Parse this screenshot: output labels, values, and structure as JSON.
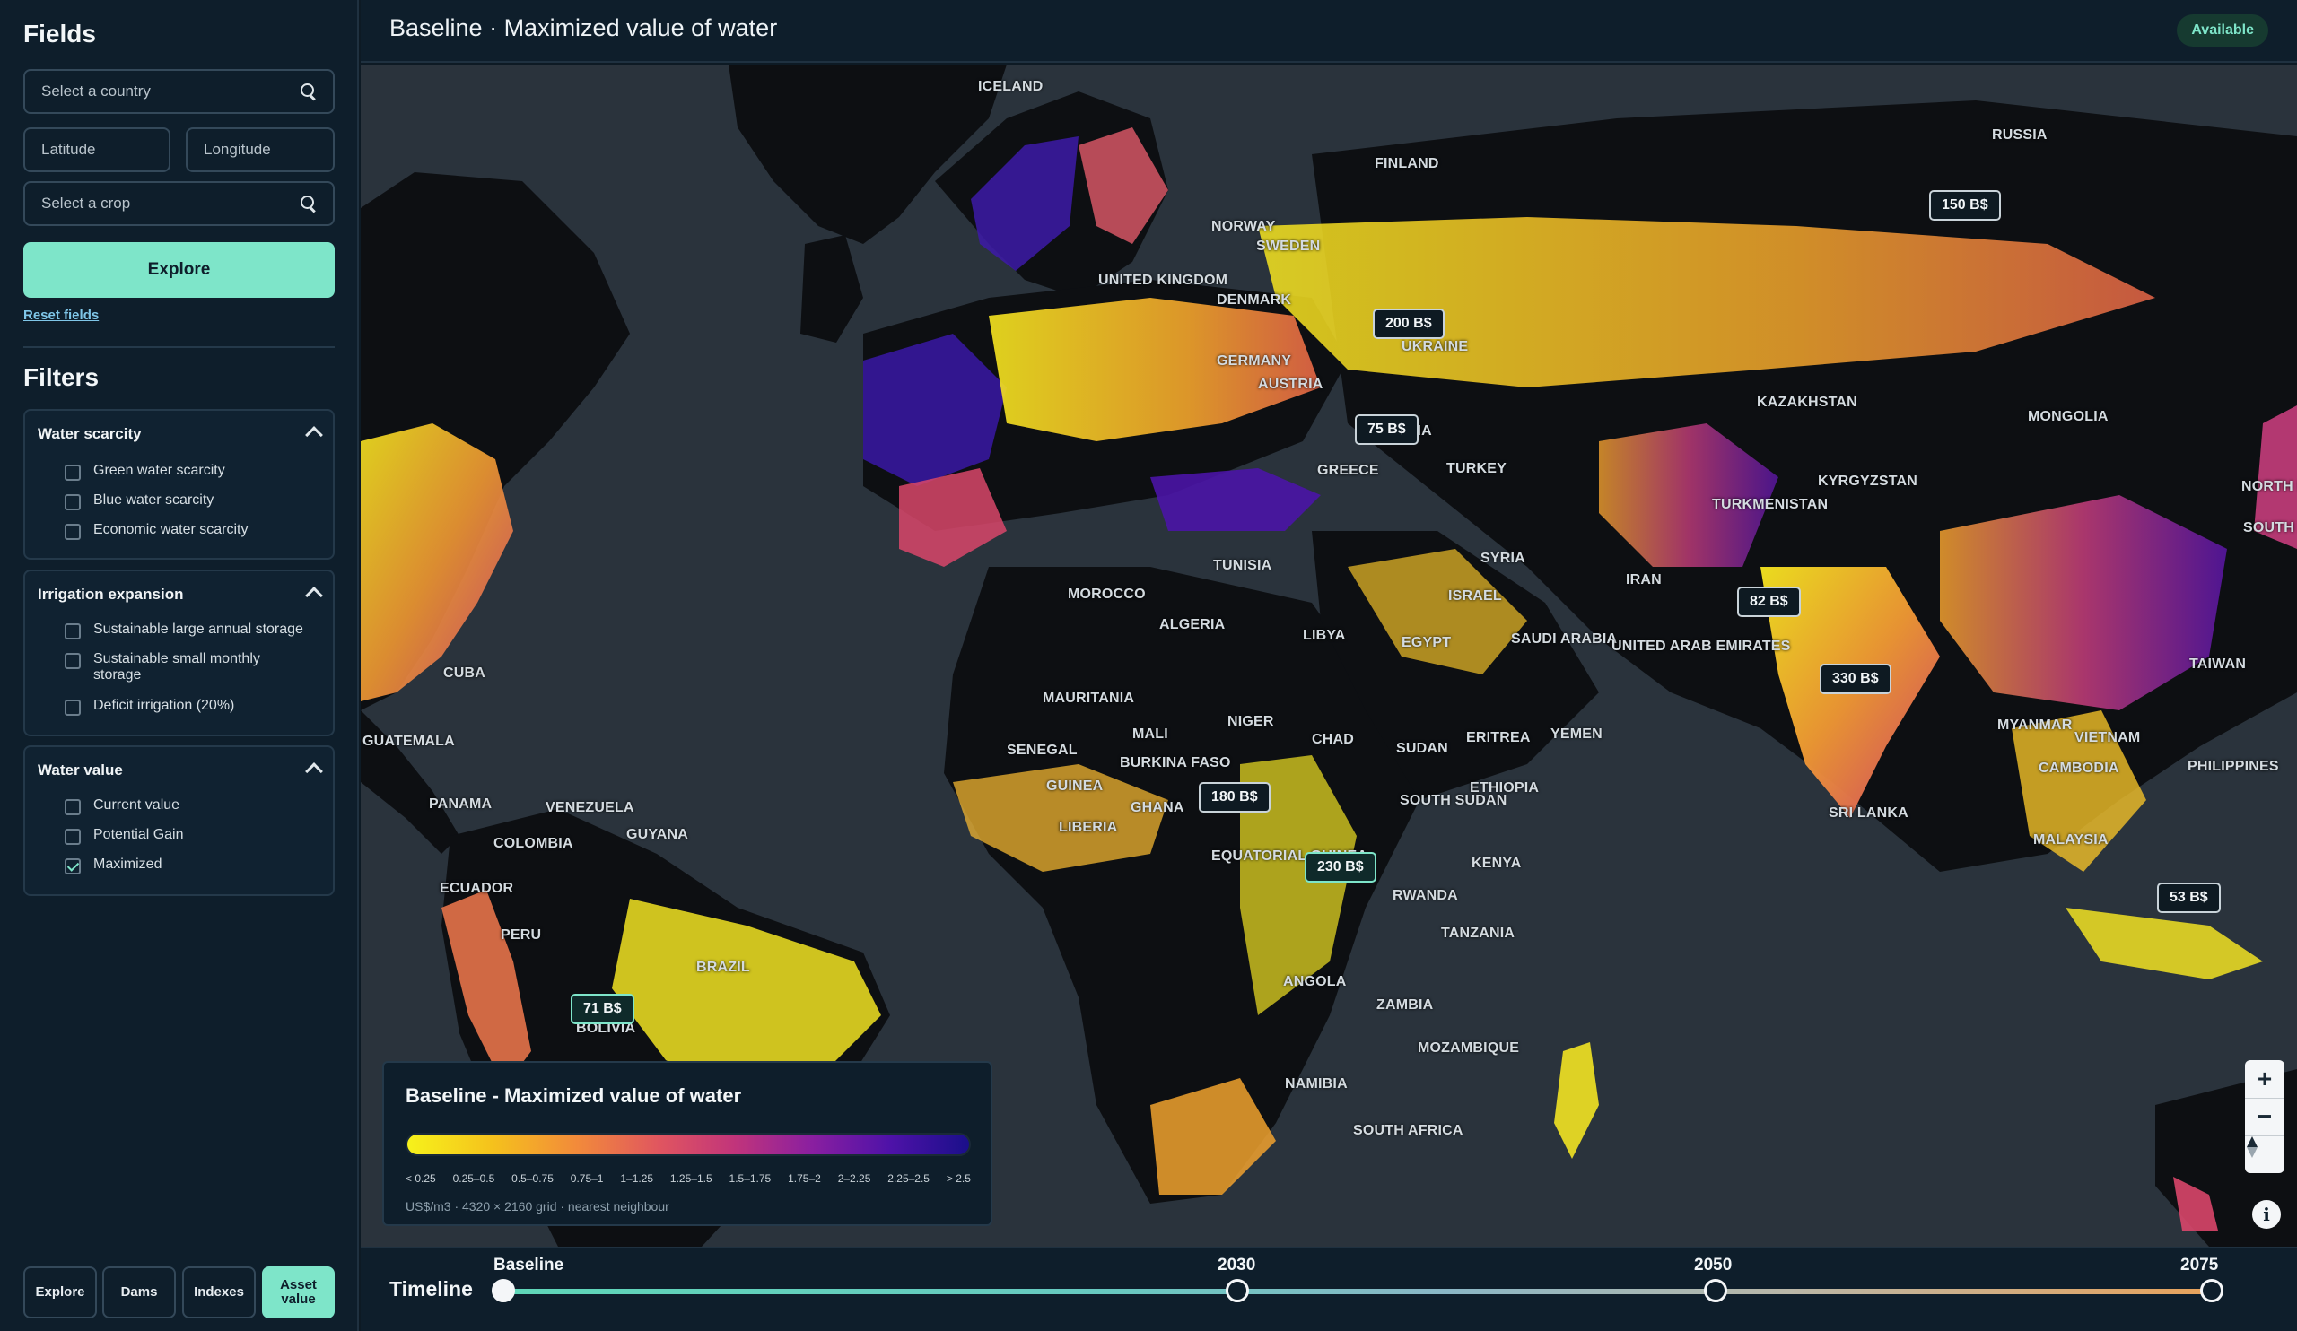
{
  "sidebar": {
    "fields_title": "Fields",
    "country_placeholder": "Select a country",
    "latitude_placeholder": "Latitude",
    "longitude_placeholder": "Longitude",
    "crop_placeholder": "Select a crop",
    "explore_label": "Explore",
    "reset_label": "Reset fields",
    "filters_title": "Filters",
    "filters": [
      {
        "title": "Water scarcity",
        "options": [
          {
            "label": "Green water scarcity",
            "checked": false
          },
          {
            "label": "Blue water scarcity",
            "checked": false
          },
          {
            "label": "Economic water scarcity",
            "checked": false
          }
        ]
      },
      {
        "title": "Irrigation expansion",
        "options": [
          {
            "label": "Sustainable large annual storage",
            "checked": false
          },
          {
            "label": "Sustainable small monthly storage",
            "checked": false
          },
          {
            "label": "Deficit irrigation (20%)",
            "checked": false
          }
        ]
      },
      {
        "title": "Water value",
        "options": [
          {
            "label": "Current value",
            "checked": false
          },
          {
            "label": "Potential Gain",
            "checked": false
          },
          {
            "label": "Maximized",
            "checked": true
          }
        ]
      }
    ],
    "nav": [
      {
        "label": "Explore",
        "active": false
      },
      {
        "label": "Dams",
        "active": false
      },
      {
        "label": "Indexes",
        "active": false
      },
      {
        "label": "Asset value",
        "active": true
      }
    ]
  },
  "header": {
    "title": "Baseline · Maximized value of water",
    "status": "Available"
  },
  "map": {
    "countries": [
      "ICELAND",
      "RUSSIA",
      "NORWAY",
      "SWEDEN",
      "FINLAND",
      "UNITED KINGDOM",
      "DENMARK",
      "GERMANY",
      "UKRAINE",
      "AUSTRIA",
      "ROMANIA",
      "GREECE",
      "TURKEY",
      "KAZAKHSTAN",
      "MONGOLIA",
      "TURKMENISTAN",
      "KYRGYZSTAN",
      "TUNISIA",
      "MOROCCO",
      "ALGERIA",
      "LIBYA",
      "EGYPT",
      "SYRIA",
      "ISRAEL",
      "IRAN",
      "SAUDI ARABIA",
      "UNITED ARAB EMIRATES",
      "YEMEN",
      "MAURITANIA",
      "MALI",
      "NIGER",
      "CHAD",
      "SUDAN",
      "ERITREA",
      "ETHIOPIA",
      "SENEGAL",
      "BURKINA FASO",
      "GUINEA",
      "GHANA",
      "LIBERIA",
      "SOUTH SUDAN",
      "EQUATORIAL GUINEA",
      "KENYA",
      "RWANDA",
      "TANZANIA",
      "ANGOLA",
      "ZAMBIA",
      "MOZAMBIQUE",
      "NAMIBIA",
      "SOUTH AFRICA",
      "CUBA",
      "GUATEMALA",
      "PANAMA",
      "VENEZUELA",
      "GUYANA",
      "COLOMBIA",
      "ECUADOR",
      "PERU",
      "BRAZIL",
      "BOLIVIA",
      "TAIWAN",
      "MYANMAR",
      "VIETNAM",
      "CAMBODIA",
      "PHILIPPINES",
      "MALAYSIA",
      "SRI LANKA",
      "NORTH KOREA",
      "SOUTH KOREA"
    ],
    "markers": [
      "150 B$",
      "200 B$",
      "75 B$",
      "82 B$",
      "330 B$",
      "180 B$",
      "230 B$",
      "53 B$",
      "71 B$"
    ],
    "legend": {
      "title": "Baseline - Maximized value of water",
      "ticks": [
        "< 0.25",
        "0.25–0.5",
        "0.5–0.75",
        "0.75–1",
        "1–1.25",
        "1.25–1.5",
        "1.5–1.75",
        "1.75–2",
        "2–2.25",
        "2.25–2.5",
        "> 2.5"
      ],
      "note": "US$/m3 · 4320 × 2160 grid · nearest neighbour"
    },
    "zoom_in": "+",
    "zoom_out": "−",
    "info": "i"
  },
  "timeline": {
    "label": "Timeline",
    "years": [
      "Baseline",
      "2030",
      "2050",
      "2075"
    ],
    "selected": 0
  },
  "colors": {
    "accent": "#7ee5c9",
    "background": "#0e1e2b",
    "ocean": "#2a333c",
    "land": "#0d0f12"
  }
}
